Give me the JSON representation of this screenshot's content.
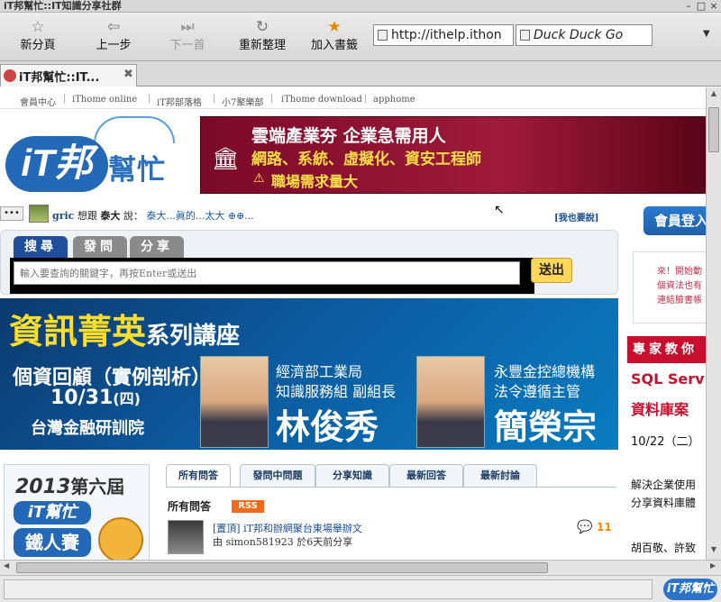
{
  "window": {
    "title": "iT邦幫忙::IT知識分享社群",
    "buttons": [
      "–",
      "□",
      "×"
    ]
  },
  "toolbar": {
    "new_tab": "新分頁",
    "back": "上一步",
    "forward": "下一首",
    "reload": "重新整理",
    "bookmark": "加入書籤",
    "url": "http://ithelp.ithon",
    "search_placeholder": "Duck Duck Go",
    "dropdown": "▼"
  },
  "tabs": [
    {
      "label": "iT邦幫忙::IT...",
      "close": "✖"
    }
  ],
  "topnav": [
    "會員中心",
    "iThome online",
    "iT邦部落格",
    "小7聚樂部",
    "iThome download",
    "apphome"
  ],
  "site": {
    "logo_text": "iT邦",
    "logo_sub": "幫忙"
  },
  "ad": {
    "line1": "雲端產業夯  企業急需用人",
    "line2": "網路、系統、虛擬化、資安工程師",
    "line3": "職場需求量大"
  },
  "chat": {
    "dots": "•••",
    "user": "gric",
    "wants": "想跟",
    "target": "泰大",
    "said": "說：",
    "message": "泰大...眞的...太大 ⊕⊕...",
    "mine": "[我也要說]"
  },
  "search": {
    "tab_search": "搜尋",
    "tab_ask": "發問",
    "tab_share": "分享",
    "placeholder": "輸入要查詢的關鍵字，再按Enter或送出",
    "submit": "送出"
  },
  "lecture": {
    "title": "資訊菁英",
    "title_suffix": "系列講座",
    "sub1": "個資回顧（實例剖析）",
    "date": "10/31",
    "weekday": "(四)",
    "venue": "台灣金融研訓院",
    "p1_org": "經濟部工業局",
    "p1_role": "知識服務組 副組長",
    "p1_name": "林俊秀",
    "p2_org": "永豐金控總機構",
    "p2_role": "法令遵循主管",
    "p2_name": "簡榮宗"
  },
  "ironman": {
    "year": "2013",
    "edition": "第六屆",
    "line1": "iT幫忙",
    "line2": "鐵人賽"
  },
  "qtabs": [
    "所有問答",
    "發問中問題",
    "分享知識",
    "最新回答",
    "最新討論"
  ],
  "questions": {
    "heading": "所有問答",
    "rss": "RSS",
    "items": [
      {
        "title": "[置頂] iT邦和辦網聚台東場舉辦文",
        "meta": "由 simon581923 於6天前分享",
        "count": "11"
      }
    ]
  },
  "sidebar": {
    "login": "會員登入",
    "box_line1": "來！開始動",
    "box_line2": "個資法也有",
    "box_line3": "連結臉書帳",
    "expert_bar": "專家教你",
    "sql1": "SQL Serv",
    "sql2": "資料庫案",
    "sql3": "10/22（二）",
    "sql4": "解決企業使用",
    "sql5": "分享資料庫體",
    "sql6": "胡百敬、許致"
  },
  "status": {
    "logo": "iT邦幫忙"
  }
}
